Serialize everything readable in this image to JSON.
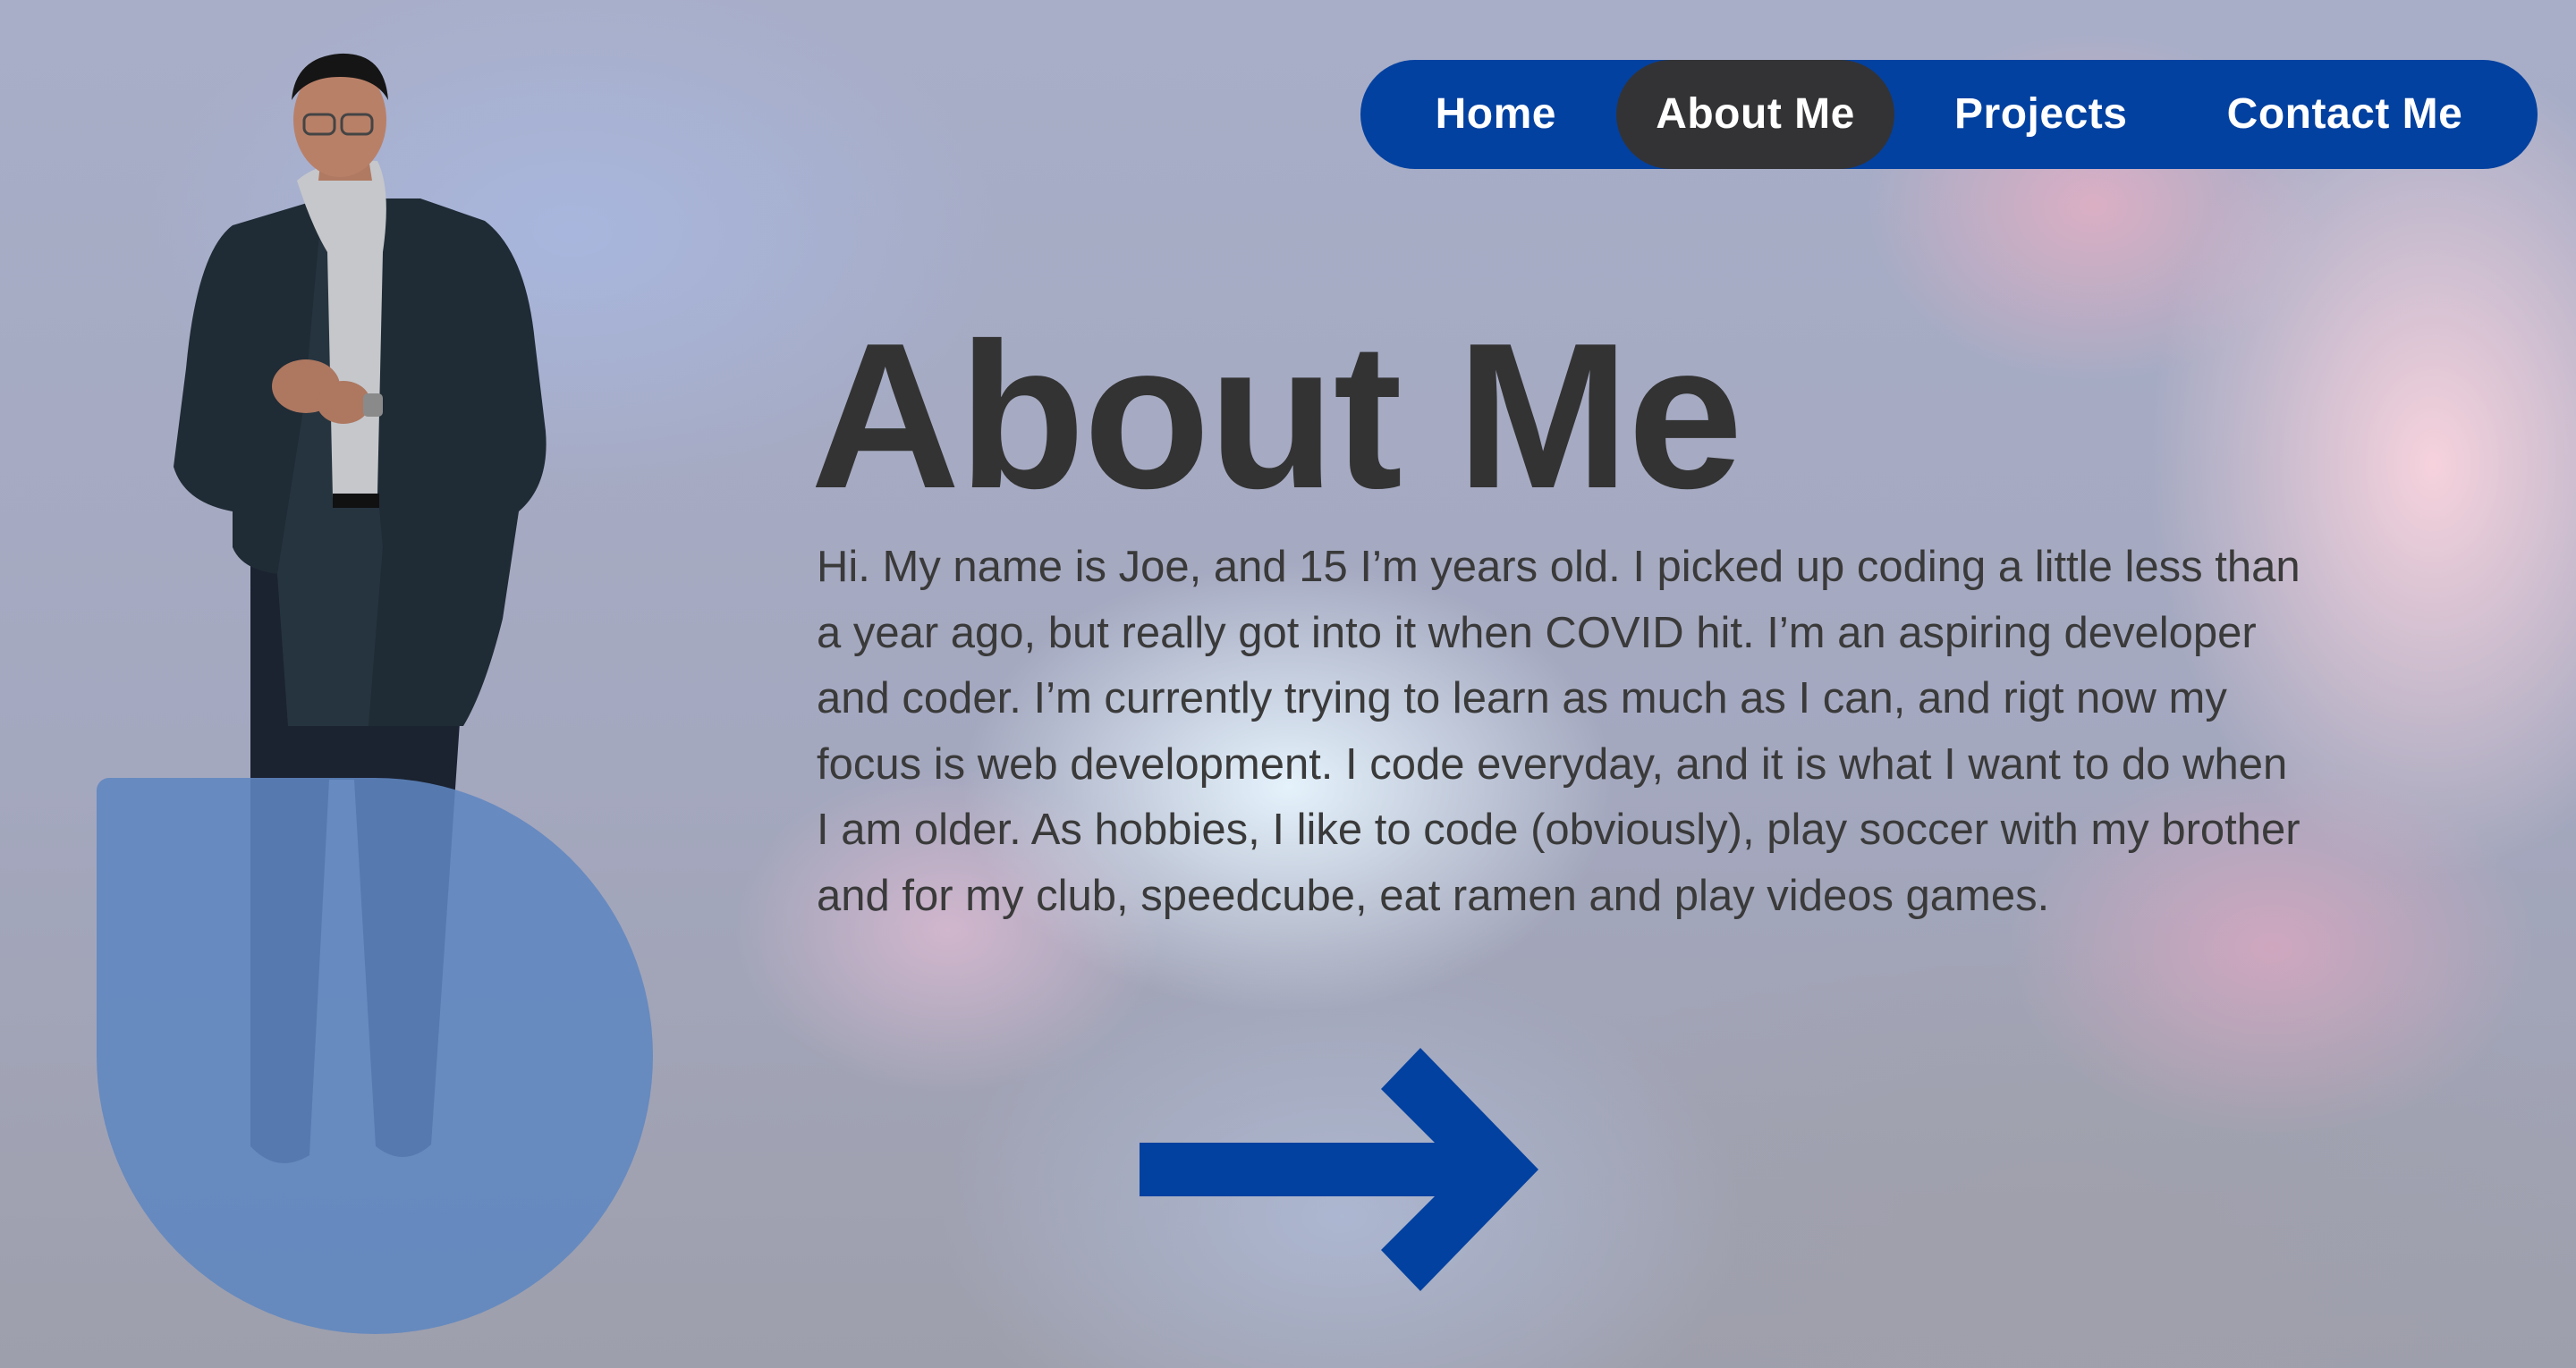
{
  "nav": {
    "items": [
      {
        "label": "Home",
        "active": false
      },
      {
        "label": "About Me",
        "active": true
      },
      {
        "label": "Projects",
        "active": false
      },
      {
        "label": "Contact Me",
        "active": false
      }
    ]
  },
  "hero": {
    "title": "About Me",
    "bio": "Hi. My name is Joe, and 15 I’m years old. I picked up coding a little less than a year ago, but really got into it when COVID hit. I’m an aspiring developer and coder. I’m currently trying to learn as much as I can, and rigt now my focus is web development. I code everyday, and it is what I want to do when I am older. As hobbies, I like to code (obviously), play soccer with my brother and for my club, speedcube, eat ramen and play videos games.",
    "next_icon": "arrow-right-icon"
  },
  "colors": {
    "accent_blue": "#0341a0",
    "active_pill": "#333336",
    "heading_text": "#333333",
    "blob": "#5e86c0"
  }
}
